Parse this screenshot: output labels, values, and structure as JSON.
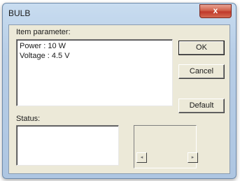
{
  "window": {
    "title": "BULB",
    "close_glyph": "x"
  },
  "item_parameter": {
    "label": "Item parameter:",
    "lines": [
      "Power : 10 W",
      "Voltage : 4.5 V"
    ]
  },
  "buttons": {
    "ok": "OK",
    "cancel": "Cancel",
    "default": "Default"
  },
  "status": {
    "label": "Status:",
    "value": ""
  },
  "scroll": {
    "left_arrow": "◂",
    "right_arrow": "▸"
  },
  "colors": {
    "close_button": "#c0392b",
    "dialog_face": "#ece9d8",
    "frame": "#b7cde6"
  }
}
